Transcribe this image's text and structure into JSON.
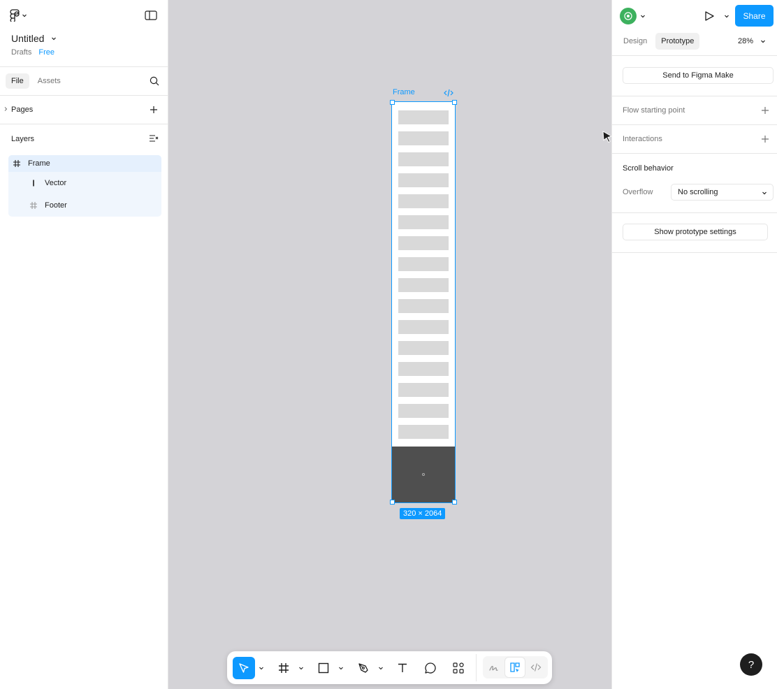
{
  "file": {
    "title": "Untitled",
    "location": "Drafts",
    "plan": "Free"
  },
  "left_tabs": [
    "File",
    "Assets"
  ],
  "pages_label": "Pages",
  "layers_label": "Layers",
  "layers": [
    {
      "name": "Frame",
      "icon": "frame-icon"
    },
    {
      "name": "Vector",
      "icon": "vector-icon"
    },
    {
      "name": "Footer",
      "icon": "frame-icon"
    }
  ],
  "right": {
    "share_label": "Share",
    "mode_tabs": [
      "Design",
      "Prototype"
    ],
    "active_mode": "Prototype",
    "zoom": "28%",
    "make_button": "Send to Figma Make",
    "flow_label": "Flow starting point",
    "interactions_label": "Interactions",
    "scroll_title": "Scroll behavior",
    "overflow_label": "Overflow",
    "overflow_value": "No scrolling",
    "settings_button": "Show prototype settings"
  },
  "canvas": {
    "frame_label": "Frame",
    "size_badge": "320 × 2064",
    "placeholder_rows": 16
  },
  "toolbar": {
    "tools": [
      "move-tool",
      "frame-tool",
      "shape-tool",
      "pen-tool",
      "text-tool",
      "comment-tool",
      "actions-tool"
    ],
    "active_tool": "move-tool",
    "modes": [
      "draw-mode",
      "design-mode",
      "dev-mode"
    ],
    "active_mode": "design-mode"
  },
  "colors": {
    "accent": "#0d99ff",
    "canvas": "#d4d3d7",
    "footer": "#4f4f4f",
    "placeholder": "#d9d9d9"
  },
  "help_label": "?"
}
